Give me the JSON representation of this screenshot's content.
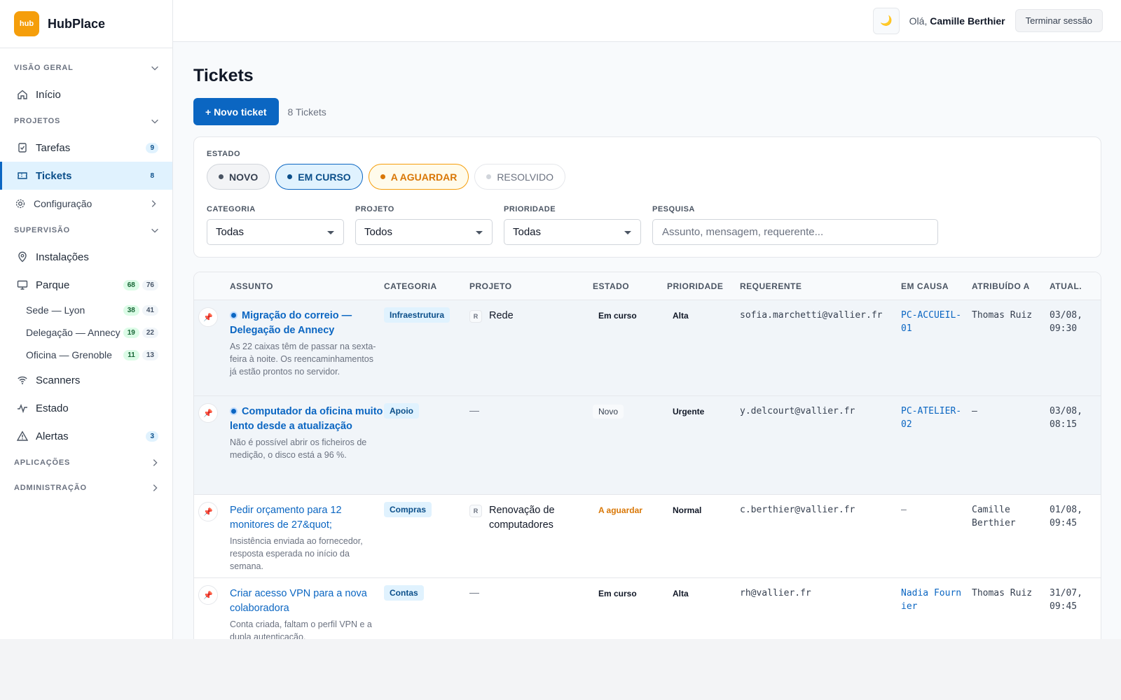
{
  "brand": {
    "logo_text": "hub",
    "name": "HubPlace",
    "color": "#f59e0b"
  },
  "header": {
    "theme_icon": "moon-icon",
    "theme_glyph": "🌙",
    "greeting": "Olá,",
    "user": "Camille Berthier",
    "logout": "Terminar sessão"
  },
  "sidebar": {
    "sections": {
      "overview": "VISÃO GERAL",
      "projects": "PROJETOS",
      "supervision": "SUPERVISÃO",
      "apps": "APLICAÇÕES",
      "admin": "ADMINISTRAÇÃO"
    },
    "inicio": "Início",
    "tarefas": {
      "label": "Tarefas",
      "count": "9"
    },
    "tickets": {
      "label": "Tickets",
      "count": "8"
    },
    "configuracao": "Configuração",
    "instalacoes": "Instalações",
    "parque": {
      "label": "Parque",
      "ok": "68",
      "total": "76"
    },
    "sites": [
      {
        "label": "Sede — Lyon",
        "ok": "38",
        "total": "41"
      },
      {
        "label": "Delegação — Annecy",
        "ok": "19",
        "total": "22"
      },
      {
        "label": "Oficina — Grenoble",
        "ok": "11",
        "total": "13"
      }
    ],
    "scanners": "Scanners",
    "estado": "Estado",
    "alertas": {
      "label": "Alertas",
      "count": "3"
    }
  },
  "page": {
    "title": "Tickets",
    "new_button": "+ Novo ticket",
    "count": "8 Tickets"
  },
  "filters": {
    "estado_label": "ESTADO",
    "pills": {
      "novo": "NOVO",
      "curso": "EM CURSO",
      "aguardar": "A AGUARDAR",
      "resolvido": "RESOLVIDO"
    },
    "categoria_label": "CATEGORIA",
    "categoria_value": "Todas",
    "projeto_label": "PROJETO",
    "projeto_value": "Todos",
    "prioridade_label": "PRIORIDADE",
    "prioridade_value": "Todas",
    "pesquisa_label": "PESQUISA",
    "pesquisa_placeholder": "Assunto, mensagem, requerente..."
  },
  "table": {
    "columns": {
      "assunto": "ASSUNTO",
      "categoria": "CATEGORIA",
      "projeto": "PROJETO",
      "estado": "ESTADO",
      "prioridade": "PRIORIDADE",
      "requerente": "REQUERENTE",
      "em_causa": "EM CAUSA",
      "atribuido": "ATRIBUÍDO A",
      "atual": "ATUAL."
    },
    "rows": [
      {
        "title": "Migração do correio — Delegação de Annecy",
        "message": "As 22 caixas têm de passar na sexta-feira à noite. Os reencaminhamentos já estão prontos no servidor.",
        "category": "Infraestrutura",
        "project_icon": "R",
        "project": "Rede",
        "status": "Em curso",
        "priority": "Alta",
        "requester": "sofia.marchetti@vallier.fr",
        "subject_ref": "PC-ACCUEIL-01",
        "assigned": "Thomas Ruiz",
        "updated": "03/08, 09:30"
      },
      {
        "title": "Computador da oficina muito lento desde a atualização",
        "message": "Não é possível abrir os ficheiros de medição, o disco está a 96 %.",
        "category": "Apoio",
        "project": "—",
        "status": "Novo",
        "priority": "Urgente",
        "requester": "y.delcourt@vallier.fr",
        "subject_ref": "PC-ATELIER-02",
        "assigned": "—",
        "updated": "03/08, 08:15"
      },
      {
        "title": "Pedir orçamento para 12 monitores de 27&quot;",
        "message": "Insistência enviada ao fornecedor, resposta esperada no início da semana.",
        "category": "Compras",
        "project_icon": "R",
        "project": "Renovação de computadores",
        "status": "A aguardar",
        "priority": "Normal",
        "requester": "c.berthier@vallier.fr",
        "subject_ref": "—",
        "assigned": "Camille Berthier",
        "updated": "01/08, 09:45"
      },
      {
        "title": "Criar acesso VPN para a nova colaboradora",
        "message": "Conta criada, faltam o perfil VPN e a dupla autenticação.",
        "category": "Contas",
        "project": "—",
        "status": "Em curso",
        "priority": "Alta",
        "requester": "rh@vallier.fr",
        "subject_ref": "Nadia Fournier",
        "assigned": "Thomas Ruiz",
        "updated": "31/07, 09:45"
      }
    ]
  }
}
